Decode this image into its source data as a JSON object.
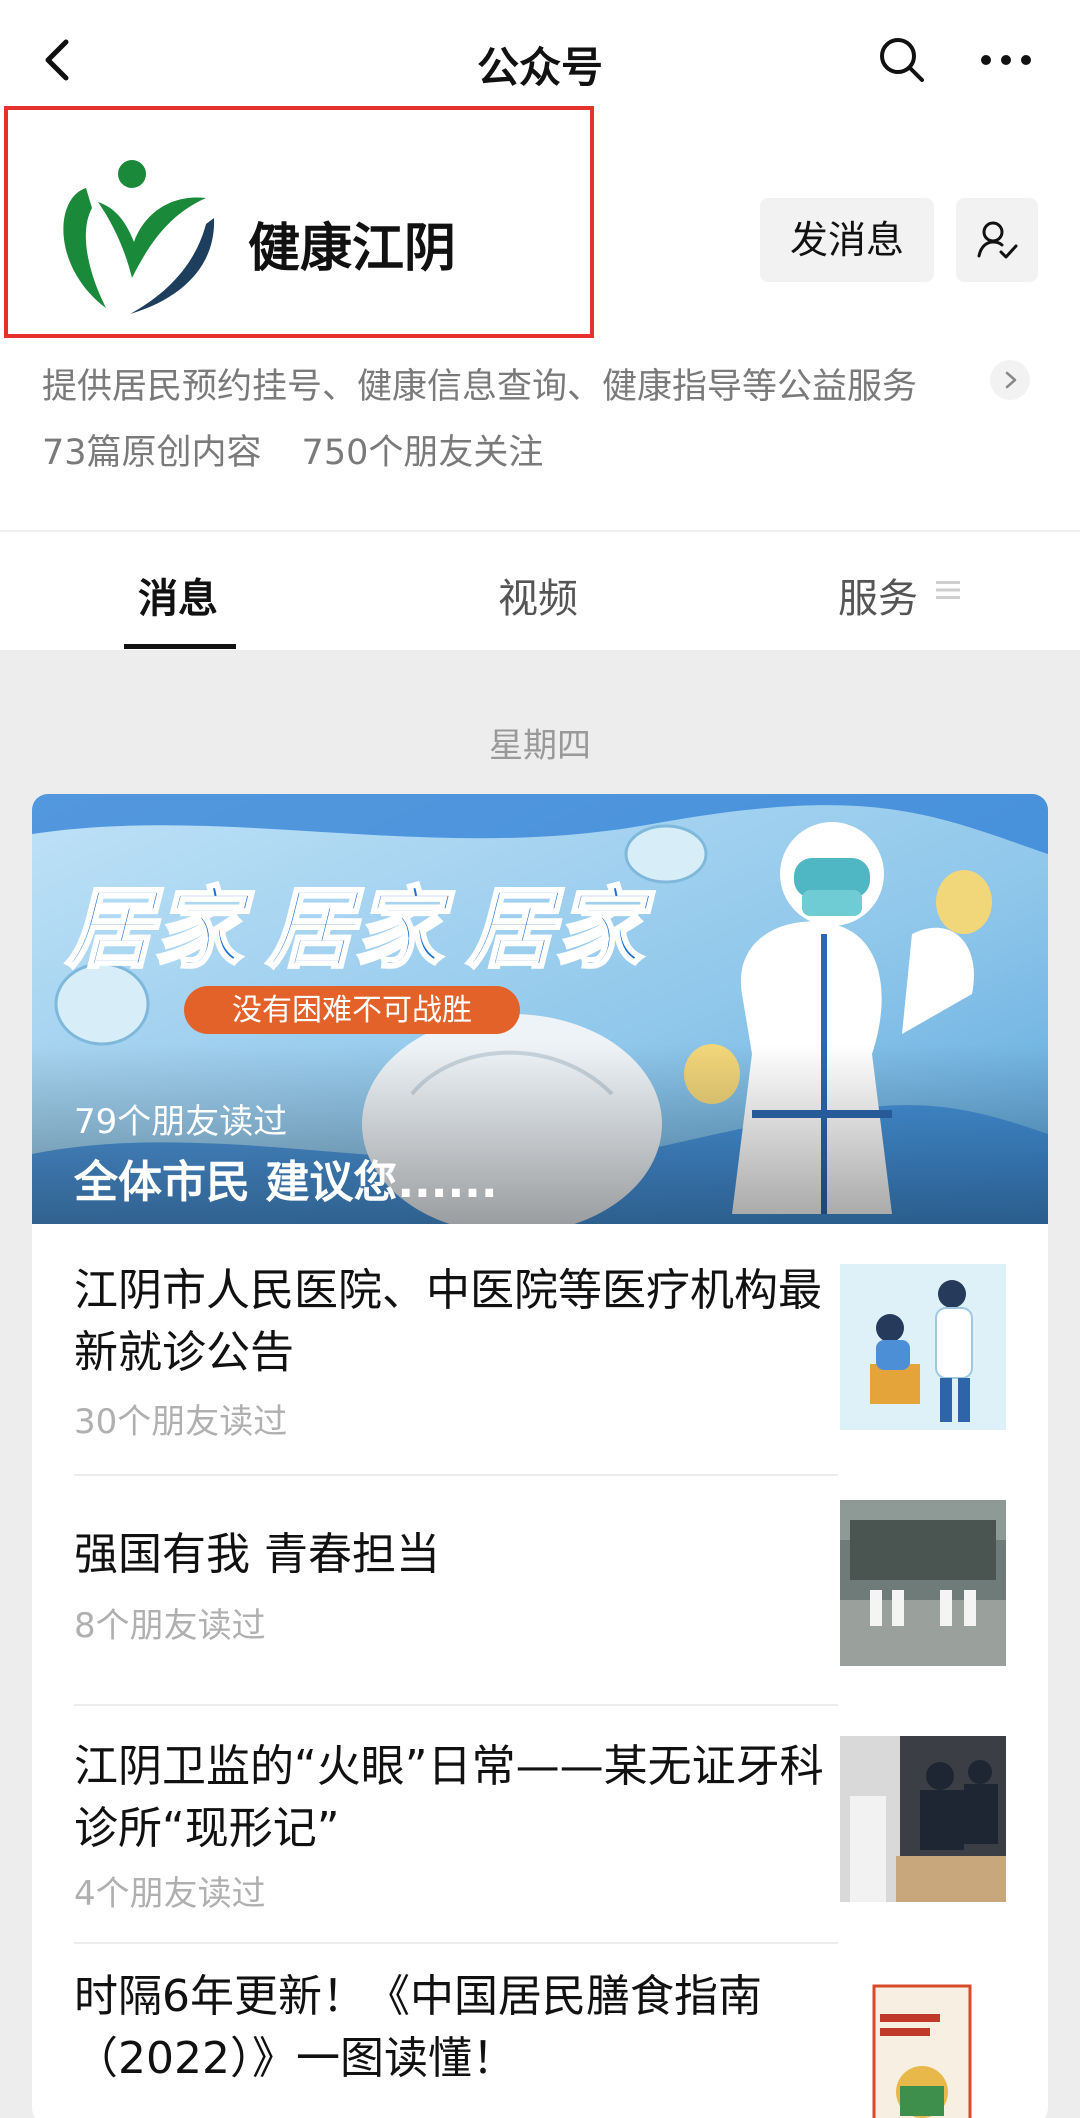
{
  "navbar": {
    "title": "公众号"
  },
  "account": {
    "name": "健康江阴",
    "send_message_label": "发消息",
    "description": "提供居民预约挂号、健康信息查询、健康指导等公益服务",
    "original_count": "73篇原创内容",
    "friends_following": "750个朋友关注"
  },
  "tabs": [
    {
      "label": "消息",
      "active": true
    },
    {
      "label": "视频",
      "active": false
    },
    {
      "label": "服务",
      "active": false
    }
  ],
  "feed": {
    "day": "星期四",
    "banner": {
      "headline": "居家 居家 居家",
      "slogan": "没有困难不可战胜",
      "readers": "79个朋友读过",
      "title": "全体市民  建议您......"
    },
    "articles": [
      {
        "title": "江阴市人民医院、中医院等医疗机构最新就诊公告",
        "readers": "30个朋友读过",
        "thumb": "doctor-vaccinating-patient-illustration"
      },
      {
        "title": "强国有我 青春担当",
        "readers": "8个朋友读过",
        "thumb": "staff-group-photo"
      },
      {
        "title": "江阴卫监的“火眼”日常——某无证牙科诊所“现形记”",
        "readers": "4个朋友读过",
        "thumb": "clinic-inspection-photo"
      },
      {
        "title": "时隔6年更新！《中国居民膳食指南（2022）》一图读懂！",
        "readers": "",
        "thumb": "dietary-guidelines-book-cover"
      }
    ]
  },
  "colors": {
    "highlight_border": "#e5322d",
    "logo_green": "#1a8a3a",
    "logo_navy": "#1d3e5c",
    "banner_blue": "#2f7fd6",
    "slogan_orange": "#e2622a"
  },
  "icons": [
    "back-arrow-icon",
    "search-icon",
    "more-icon",
    "follow-user-icon",
    "chevron-right-icon",
    "menu-icon"
  ]
}
